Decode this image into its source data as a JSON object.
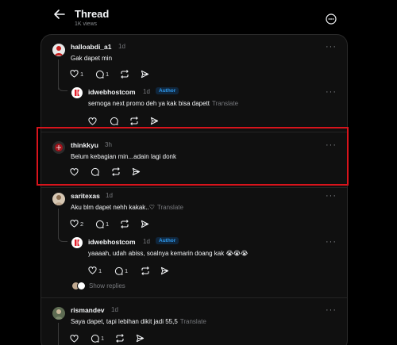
{
  "header": {
    "title": "Thread",
    "views": "1K views"
  },
  "posts": [
    {
      "username": "halloabdi_a1",
      "time": "1d",
      "text": "Gak dapet min",
      "likes": "1",
      "comments": "1",
      "avatar_color": "#c7201f"
    },
    {
      "username": "idwebhostcom",
      "time": "1d",
      "badge": "Author",
      "text": "semoga next promo deh ya kak bisa dapett",
      "translate": "Translate",
      "avatar_color": "#e11d2a"
    },
    {
      "username": "thinkkyu",
      "time": "3h",
      "text": "Belum kebagian min...adain lagi donk",
      "avatar_color": "#a3131b"
    },
    {
      "username": "saritexas",
      "time": "1d",
      "text": "Aku blm dapet nehh kakak..♡",
      "translate": "Translate",
      "likes": "2",
      "comments": "1",
      "avatar_color": "#bfa88f"
    },
    {
      "username": "idwebhostcom",
      "time": "1d",
      "badge": "Author",
      "text": "yaaaah, udah abiss, soalnya kemarin doang kak 😭😭😭",
      "likes": "1",
      "comments": "1",
      "avatar_color": "#e11d2a"
    },
    {
      "username": "rismandev",
      "time": "1d",
      "text": "Saya dapet, tapi lebihan dikit jadi 55,5",
      "translate": "Translate",
      "comments": "1",
      "avatar_color": "#7c8a6e"
    }
  ],
  "show_replies": "Show replies",
  "colors": {
    "background": "#000000",
    "panel": "#101010",
    "accent_author": "#2f9bf0",
    "highlight_border": "#d8141c"
  },
  "icons": [
    "back-arrow-icon",
    "more-icon",
    "heart-icon",
    "comment-icon",
    "repost-icon",
    "share-icon"
  ]
}
